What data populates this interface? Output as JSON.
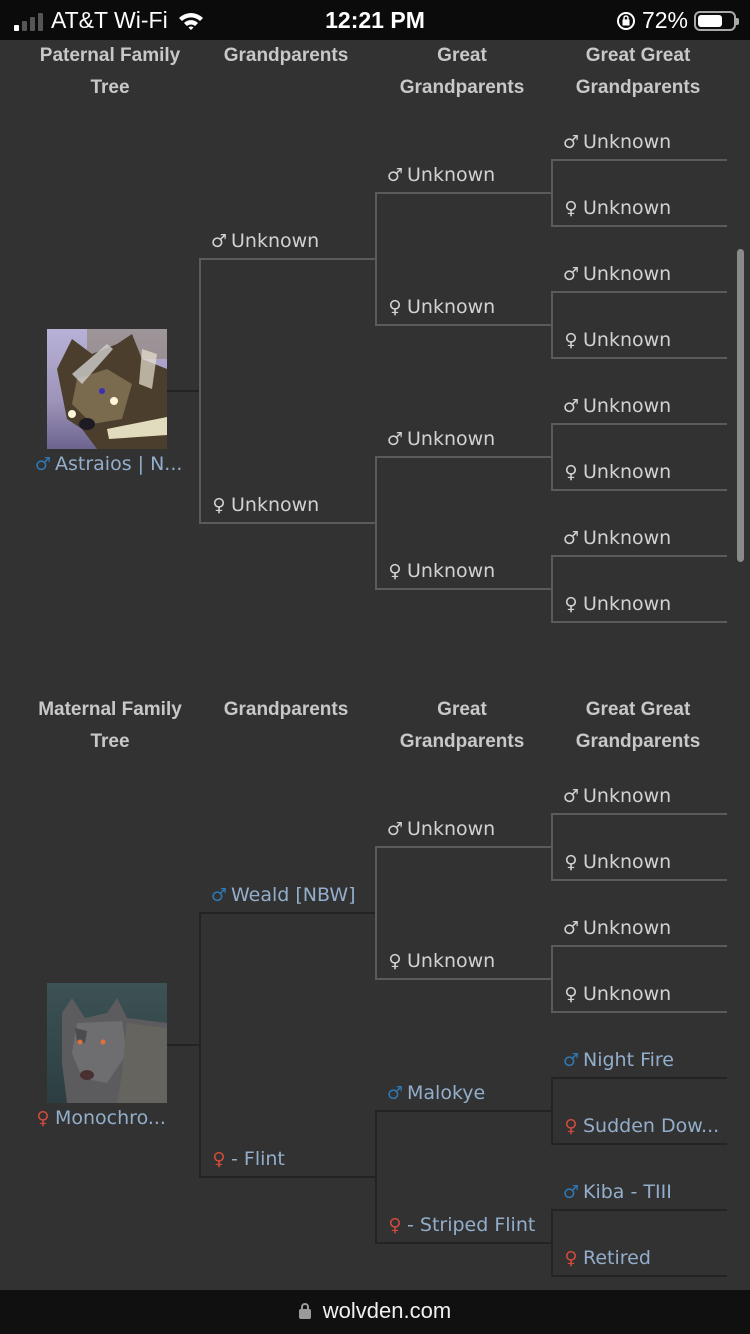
{
  "status_bar": {
    "carrier": "AT&T Wi-Fi",
    "time": "12:21 PM",
    "battery": "72%",
    "battery_level": 0.72,
    "signal_bars_on": 1,
    "signal_bars_total": 4
  },
  "headers": {
    "grandparents": "Grandparents",
    "great_line1": "Great",
    "great_line2": "Grandparents",
    "great_great_line1": "Great Great",
    "great_great_line2": "Grandparents"
  },
  "paternal": {
    "title_line1": "Paternal Family",
    "title_line2": "Tree",
    "root": {
      "sex": "male",
      "name": "Astraios | N...",
      "known": true
    },
    "grandparents": [
      {
        "sex": "male",
        "name": "Unknown",
        "known": false
      },
      {
        "sex": "female",
        "name": "Unknown",
        "known": false
      }
    ],
    "great_grandparents": [
      {
        "sex": "male",
        "name": "Unknown",
        "known": false
      },
      {
        "sex": "female",
        "name": "Unknown",
        "known": false
      },
      {
        "sex": "male",
        "name": "Unknown",
        "known": false
      },
      {
        "sex": "female",
        "name": "Unknown",
        "known": false
      }
    ],
    "great_great_grandparents": [
      {
        "sex": "male",
        "name": "Unknown",
        "known": false
      },
      {
        "sex": "female",
        "name": "Unknown",
        "known": false
      },
      {
        "sex": "male",
        "name": "Unknown",
        "known": false
      },
      {
        "sex": "female",
        "name": "Unknown",
        "known": false
      },
      {
        "sex": "male",
        "name": "Unknown",
        "known": false
      },
      {
        "sex": "female",
        "name": "Unknown",
        "known": false
      },
      {
        "sex": "male",
        "name": "Unknown",
        "known": false
      },
      {
        "sex": "female",
        "name": "Unknown",
        "known": false
      }
    ]
  },
  "maternal": {
    "title_line1": "Maternal Family",
    "title_line2": "Tree",
    "root": {
      "sex": "female",
      "name": "Monochro...",
      "known": true
    },
    "grandparents": [
      {
        "sex": "male",
        "name": "Weald [NBW]",
        "known": true
      },
      {
        "sex": "female",
        "name": "- Flint",
        "known": true
      }
    ],
    "great_grandparents": [
      {
        "sex": "male",
        "name": "Unknown",
        "known": false
      },
      {
        "sex": "female",
        "name": "Unknown",
        "known": false
      },
      {
        "sex": "male",
        "name": "Malokye",
        "known": true
      },
      {
        "sex": "female",
        "name": "- Striped Flint",
        "known": true
      }
    ],
    "great_great_grandparents": [
      {
        "sex": "male",
        "name": "Unknown",
        "known": false
      },
      {
        "sex": "female",
        "name": "Unknown",
        "known": false
      },
      {
        "sex": "male",
        "name": "Unknown",
        "known": false
      },
      {
        "sex": "female",
        "name": "Unknown",
        "known": false
      },
      {
        "sex": "male",
        "name": "Night Fire",
        "known": true
      },
      {
        "sex": "female",
        "name": "Sudden Dow...",
        "known": true
      },
      {
        "sex": "male",
        "name": "Kiba - TIII",
        "known": true
      },
      {
        "sex": "female",
        "name": "Retired",
        "known": true
      }
    ]
  },
  "icons": {
    "male": "♂",
    "female": "♀"
  },
  "colors": {
    "male_known": "#2f78b4",
    "female_known": "#d24b3c",
    "name_known": "#93aecb",
    "unknown": "#d2d2d2"
  },
  "url_bar": {
    "domain": "wolvden.com"
  }
}
